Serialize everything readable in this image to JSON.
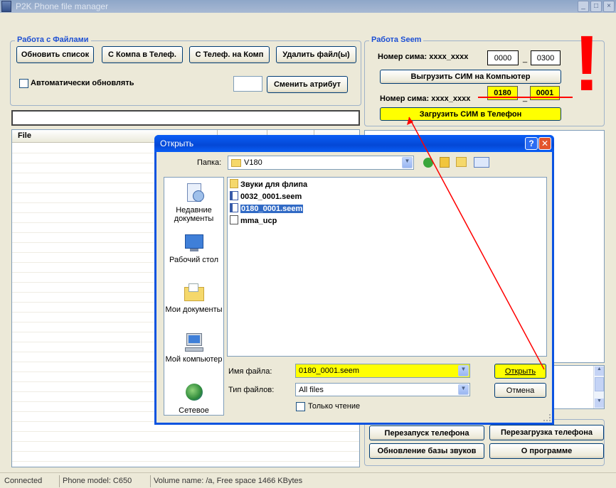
{
  "window": {
    "title": "P2K Phone file manager"
  },
  "files_group": {
    "title": "Работа с Файлами",
    "buttons": [
      "Обновить список",
      "С Компа в Телеф.",
      "С Телеф. на Комп",
      "Удалить файл(ы)"
    ],
    "auto_refresh_label": "Автоматически обновлять",
    "attr_value": "",
    "change_attr_label": "Сменить атрибут"
  },
  "path_field": {
    "value": ""
  },
  "file_list": {
    "column_header": "File"
  },
  "seem_group": {
    "title": "Работа  Seem",
    "sim_label_1": "Номер сима: xxxx_xxxx",
    "sim1_a": "0000",
    "sim1_b": "0300",
    "sim_label_2": "Номер сима: xxxx_xxxx",
    "sim2_a": "0180",
    "sim2_b": "0001",
    "separator": "_",
    "export_label": "Выгрузить СИМ на Компьютер",
    "import_label": "Загрузить СИМ в Телефон"
  },
  "annotation": {
    "mark": "!"
  },
  "bottom_buttons": {
    "restart": "Перезапуск телефона",
    "reboot": "Перезагрузка телефона",
    "update_sounds": "Обновление базы звуков",
    "about": "О программе"
  },
  "status_bar": {
    "connection": "Connected",
    "phone_model": "Phone model: C650",
    "volume": "Volume name: /a, Free space 1466 KBytes"
  },
  "dialog": {
    "title": "Открыть",
    "help": "?",
    "close": "✕",
    "folder_label": "Папка:",
    "folder_value": "V180",
    "places": [
      "Недавние документы",
      "Рабочий стол",
      "Мои документы",
      "Мой компьютер",
      "Сетевое"
    ],
    "files": [
      {
        "name": "Звуки для флипа",
        "type": "folder"
      },
      {
        "name": "0032_0001.seem",
        "type": "seem"
      },
      {
        "name": "0180_0001.seem",
        "type": "seem"
      },
      {
        "name": "mma_ucp",
        "type": "file"
      }
    ],
    "filename_label": "Имя файла:",
    "filename_value": "0180_0001.seem",
    "filetype_label": "Тип файлов:",
    "filetype_value": "All files",
    "readonly_label": "Только чтение",
    "open_button": "Открыть",
    "cancel_button": "Отмена"
  },
  "colors": {
    "highlight": "#ffff00",
    "annotation_red": "#ff0000",
    "group_title": "#1c4fd4",
    "dialog_title": "#0a5ef5"
  }
}
